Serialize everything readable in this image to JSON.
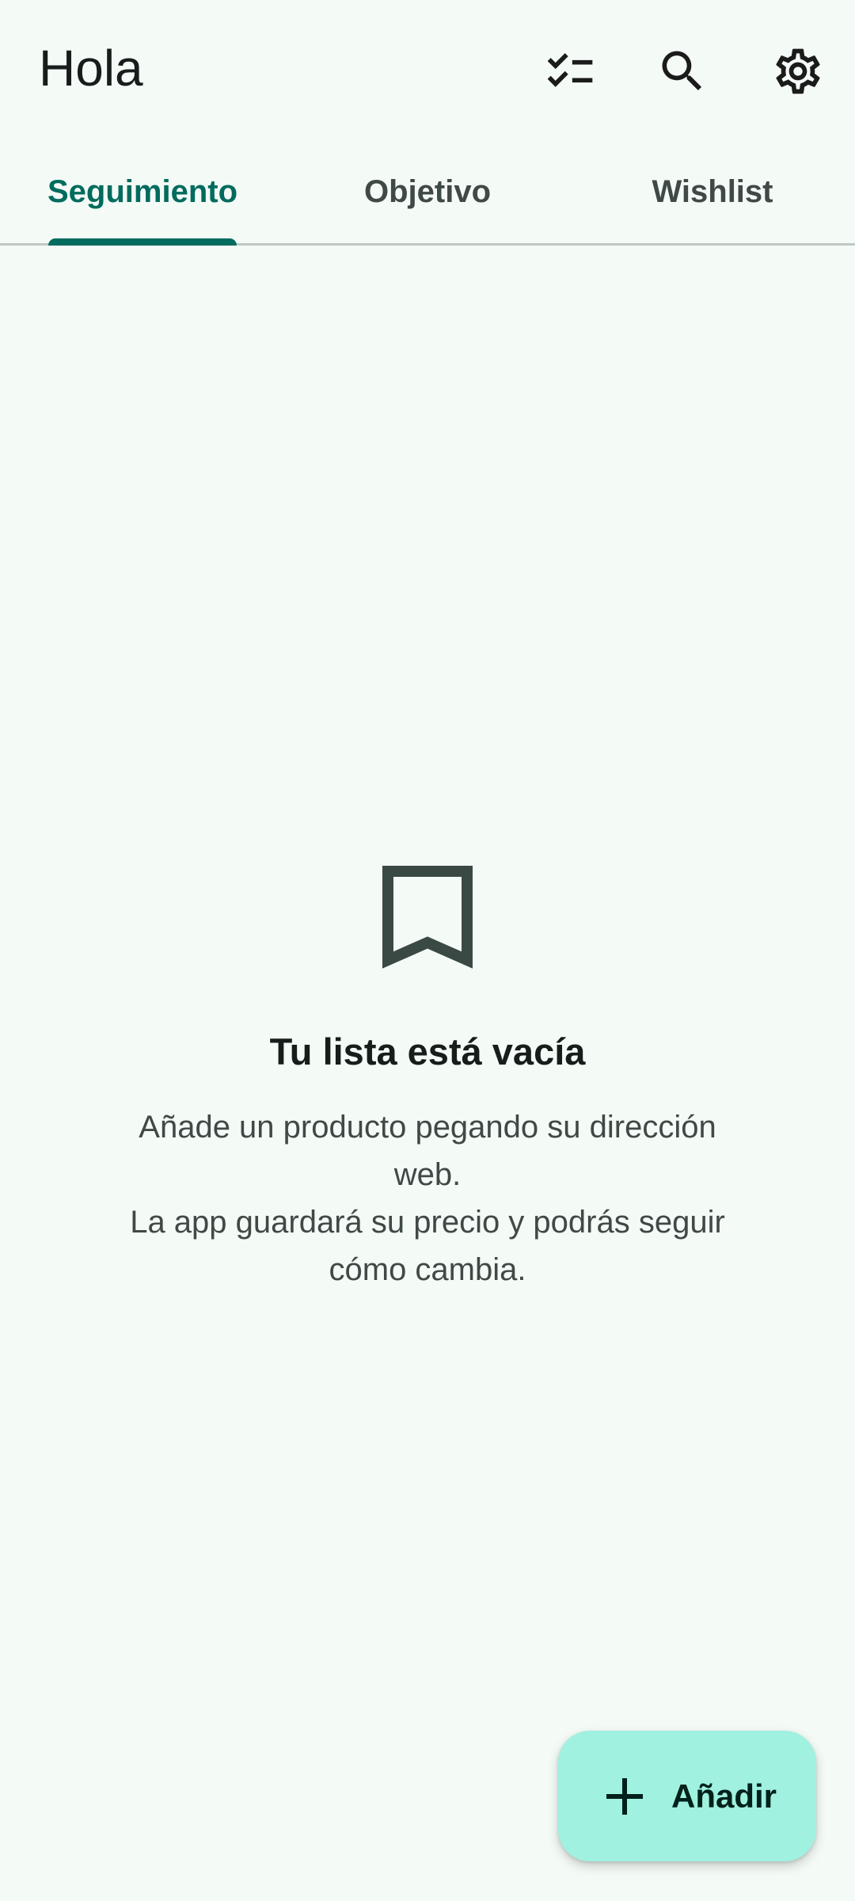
{
  "app": {
    "title": "Hola"
  },
  "toolbar": {
    "icons": [
      "checklist-icon",
      "search-icon",
      "settings-icon"
    ]
  },
  "tabs": [
    {
      "label": "Seguimiento",
      "active": true
    },
    {
      "label": "Objetivo",
      "active": false
    },
    {
      "label": "Wishlist",
      "active": false
    }
  ],
  "empty_state": {
    "icon": "bookmark-icon",
    "title": "Tu lista está vacía",
    "description": "Añade un producto pegando su dirección\nweb.\nLa app guardará su precio y podrás seguir\ncómo cambia."
  },
  "fab": {
    "icon": "plus-icon",
    "label": "Añadir"
  },
  "colors": {
    "background": "#f4faf6",
    "accent": "#006b5e",
    "fab_background": "#a0f1df"
  }
}
